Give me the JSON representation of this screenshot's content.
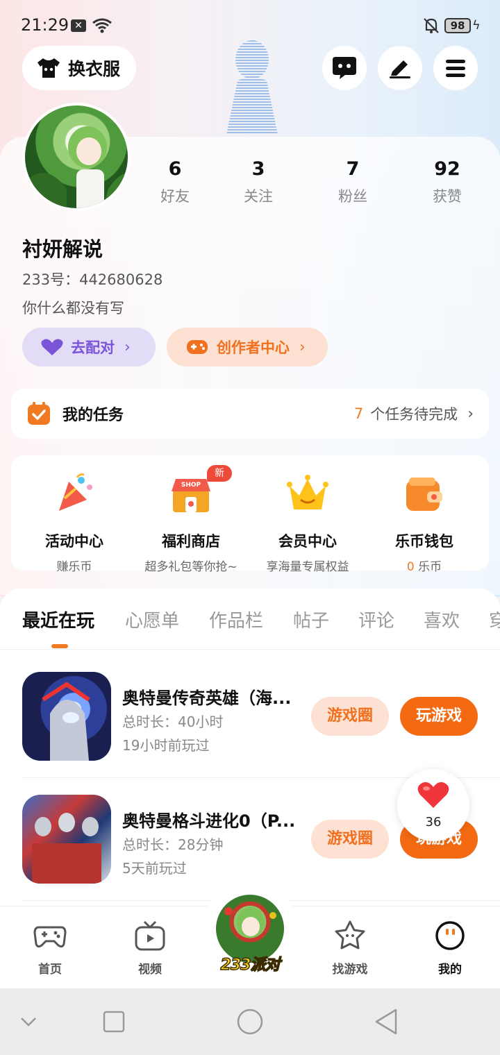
{
  "status_bar": {
    "time": "21:29",
    "battery": "98"
  },
  "header": {
    "outfit_label": "换衣服",
    "icons": [
      "chat-icon",
      "edit-icon",
      "menu-icon"
    ]
  },
  "profile": {
    "stats": [
      {
        "value": "6",
        "label": "好友"
      },
      {
        "value": "3",
        "label": "关注"
      },
      {
        "value": "7",
        "label": "粉丝"
      },
      {
        "value": "92",
        "label": "获赞"
      }
    ],
    "name": "衬妍解说",
    "id_line": "233号：442680628",
    "bio": "你什么都没有写",
    "match_label": "去配对",
    "creator_label": "创作者中心"
  },
  "tasks": {
    "title": "我的任务",
    "count": "7",
    "suffix": "个任务待完成"
  },
  "services": [
    {
      "name": "活动中心",
      "sub": "赚乐币"
    },
    {
      "name": "福利商店",
      "sub": "超多礼包等你抢~",
      "badge": "新"
    },
    {
      "name": "会员中心",
      "sub": "享海量专属权益"
    },
    {
      "name": "乐币钱包",
      "sub_count": "0",
      "sub": "乐币"
    }
  ],
  "tabs": [
    "最近在玩",
    "心愿单",
    "作品栏",
    "帖子",
    "评论",
    "喜欢",
    "穿"
  ],
  "games": [
    {
      "title": "奥特曼传奇英雄（海...",
      "duration": "总时长：40小时",
      "last_played": "19小时前玩过",
      "circle_btn": "游戏圈",
      "play_btn": "玩游戏"
    },
    {
      "title": "奥特曼格斗进化0（P...",
      "duration": "总时长：28分钟",
      "last_played": "5天前玩过",
      "circle_btn": "游戏圈",
      "play_btn": "玩游戏"
    }
  ],
  "like_count": "36",
  "bottom_nav": {
    "items": [
      "首页",
      "视频",
      "找游戏",
      "我的"
    ],
    "center_label": "233派对"
  },
  "colors": {
    "accent": "#f36a12",
    "purple": "#7a55d8",
    "new_badge": "#ee4a3a"
  }
}
